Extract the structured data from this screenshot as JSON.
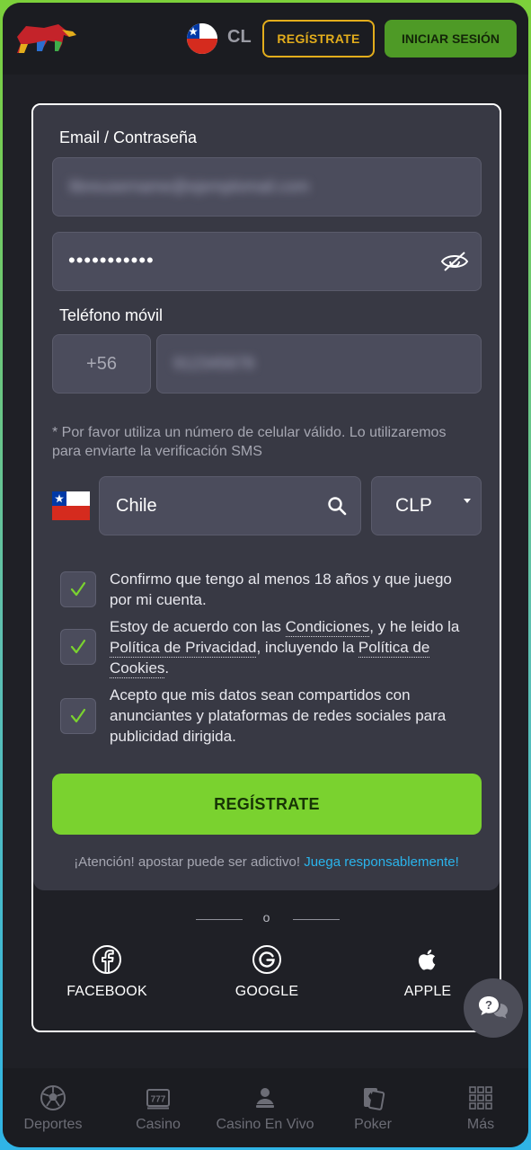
{
  "header": {
    "country_code": "CL",
    "register_label": "REGÍSTRATE",
    "login_label": "INICIAR SESIÓN"
  },
  "form": {
    "email_password_label": "Email / Contraseña",
    "email_value": "libreusername@ejemplomail.com",
    "password_value": "•••••••••••",
    "phone_label": "Teléfono móvil",
    "phone_prefix": "+56",
    "phone_value": "912345678",
    "phone_hint": "* Por favor utiliza un número de celular válido. Lo utilizaremos para enviarte la verificación SMS",
    "country_value": "Chile",
    "currency_value": "CLP",
    "checks": {
      "age": "Confirmo que tengo al menos 18 años y que juego por mi cuenta.",
      "terms_pre": "Estoy de acuerdo con las",
      "terms_link": "Condiciones",
      "terms_mid": ", y he leido la",
      "privacy_link": "Política de Privacidad",
      "terms_mid2": ", incluyendo la",
      "cookies_link": "Política de Cookies",
      "terms_end": ".",
      "data_sharing": "Acepto que mis datos sean compartidos con anunciantes y plataformas de redes sociales para publicidad dirigida."
    },
    "submit_label": "REGÍSTRATE",
    "warning_text": "¡Atención! apostar puede ser adictivo!",
    "warning_link": "Juega responsablemente!"
  },
  "social": {
    "divider_text": "o",
    "facebook": "FACEBOOK",
    "google": "GOOGLE",
    "apple": "APPLE"
  },
  "bottom_nav": {
    "sports": "Deportes",
    "casino": "Casino",
    "live_casino": "Casino En Vivo",
    "poker": "Poker",
    "more": "Más"
  },
  "colors": {
    "accent_green": "#7ad22f",
    "accent_gold": "#e3ad1c",
    "link_blue": "#2ab4ec",
    "background": "#1f2026",
    "card": "#383944"
  }
}
